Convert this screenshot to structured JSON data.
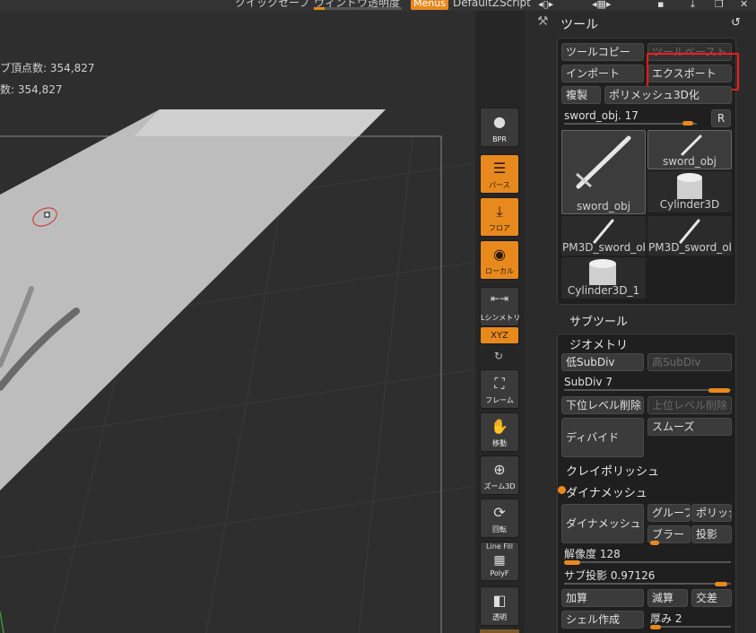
{
  "topbar": {
    "quicksave": "クイックセーブ",
    "transparency": "ウィンドウ透明度",
    "menus": "Menus",
    "script": "DefaultZScript"
  },
  "canvas": {
    "stat_line1_label": "ブ頂点数:",
    "stat_line1_value": "354,827",
    "stat_line2_label": "数:",
    "stat_line2_value": "354,827"
  },
  "shelf": {
    "bpr": "BPR",
    "perspective": "パース",
    "floor": "フロア",
    "local": "ローカル",
    "lsym": "Lシンメトリ",
    "xyz": "XYZ",
    "frame": "フレーム",
    "move": "移動",
    "zoom3d": "ズーム3D",
    "rotate": "回転",
    "linefill": "Line Fill",
    "polyf": "PolyF",
    "transp": "透明"
  },
  "tool": {
    "header": "ツール",
    "copy": "ツールコピー",
    "paste": "ツールペースト",
    "import": "インポート",
    "export": "エクスポート",
    "duplicate": "複製",
    "make_polymesh": "ポリメッシュ3D化",
    "slider_label": "sword_obj. 17",
    "r_button": "R",
    "thumbs": [
      "sword_obj",
      "sword_obj",
      "Cylinder3D",
      "PM3D_sword_ob",
      "PM3D_sword_ob",
      "Cylinder3D_1"
    ]
  },
  "subtool": {
    "header": "サブツール"
  },
  "geometry": {
    "header": "ジオメトリ",
    "lower_subdiv": "低SubDiv",
    "higher_subdiv": "高SubDiv",
    "subdiv_label": "SubDiv 7",
    "del_lower": "下位レベル削除",
    "del_higher": "上位レベル削除",
    "divide": "ディバイド",
    "smooth": "スムーズ",
    "claypolish": "クレイポリッシュ",
    "dynamesh_section": "ダイナメッシュ",
    "dynamesh_btn": "ダイナメッシュ",
    "groups": "グループ",
    "polish": "ポリッシュ",
    "blur": "ブラー",
    "project": "投影",
    "resolution": "解像度 128",
    "subproject": "サブ投影 0.97126",
    "add": "加算",
    "subtract": "減算",
    "intersect": "交差",
    "create_shell": "シェル作成",
    "thickness": "厚み 2"
  }
}
